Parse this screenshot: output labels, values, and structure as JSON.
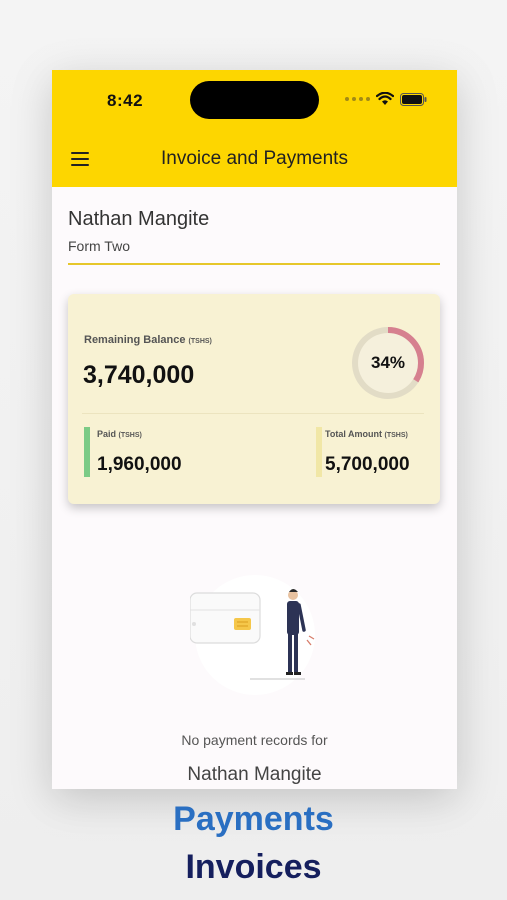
{
  "status_bar": {
    "time": "8:42"
  },
  "header": {
    "title": "Invoice and Payments",
    "menu_icon": "hamburger-menu-icon",
    "background": "#fdd600"
  },
  "student": {
    "name": "Nathan Mangite",
    "class": "Form Two"
  },
  "balance_card": {
    "remaining_label": "Remaining Balance",
    "remaining_unit": "(TSHS)",
    "remaining_value": "3,740,000",
    "progress_text": "34%",
    "progress_percent": 34,
    "paid_label": "Paid",
    "paid_unit": "(TSHS)",
    "paid_value": "1,960,000",
    "total_label": "Total Amount",
    "total_unit": "(TSHS)",
    "total_value": "5,700,000",
    "colors": {
      "card": "#f8f2d3",
      "paid_accent": "#7ccb86",
      "total_accent": "#f1e7a6",
      "progress_arc": "#d6808f"
    }
  },
  "empty_state": {
    "message": "No payment records for",
    "name": "Nathan Mangite",
    "illustration_icon": "payment-card-person-illustration"
  },
  "captions": {
    "line1": "Payments",
    "line2": "Invoices",
    "line1_color": "#2a6fc2",
    "line2_color": "#151f5e"
  }
}
